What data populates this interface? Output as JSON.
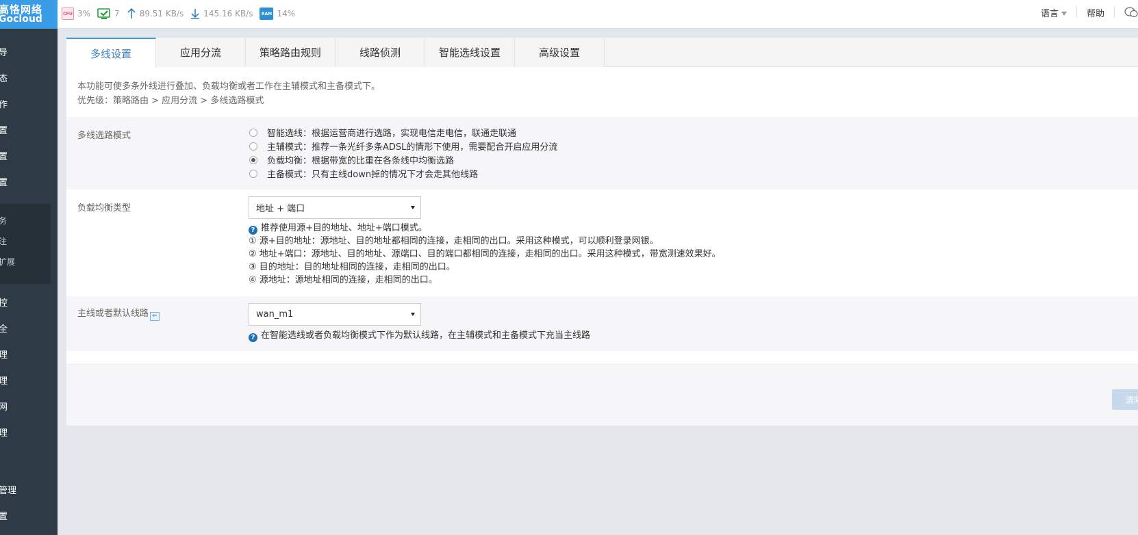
{
  "brand": {
    "name_cn": "高恪网络",
    "name_en": "Gocloud"
  },
  "stats": {
    "cpu_label": "CPU",
    "cpu": "3%",
    "connections": "7",
    "upload": "89.51 KB/s",
    "download": "145.16 KB/s",
    "ram_label": "RAM",
    "ram": "14%"
  },
  "topnav": {
    "language": "语言",
    "help": "帮助"
  },
  "sidebar": {
    "items": [
      "导",
      "态",
      "作",
      "置",
      "置",
      "置"
    ],
    "sub_items": [
      "务",
      "注",
      "扩展"
    ],
    "items2": [
      "控",
      "全",
      "理",
      "理",
      "网",
      "理"
    ],
    "items3": [
      "管理",
      "置"
    ]
  },
  "tabs": [
    "多线设置",
    "应用分流",
    "策略路由规则",
    "线路侦测",
    "智能选线设置",
    "高级设置"
  ],
  "intro": {
    "line1": "本功能可使多条外线进行叠加、负载均衡或者工作在主辅模式和主备模式下。",
    "line2": "优先级：策略路由 > 应用分流 > 多线选路模式"
  },
  "mode": {
    "label": "多线选路模式",
    "options": [
      {
        "text": "智能选线：根据运营商进行选路，实现电信走电信，联通走联通",
        "checked": false
      },
      {
        "text": "主辅模式：推荐一条光纤多条ADSL的情形下使用，需要配合开启应用分流",
        "checked": false
      },
      {
        "text": "负载均衡：根据带宽的比重在各条线中均衡选路",
        "checked": true
      },
      {
        "text": "主备模式：只有主线down掉的情况下才会走其他线路",
        "checked": false
      }
    ]
  },
  "balance": {
    "label": "负载均衡类型",
    "value": "地址 + 端口",
    "hints": [
      "推荐使用源+目的地址、地址+端口模式。",
      "① 源+目的地址：源地址、目的地址都相同的连接，走相同的出口。采用这种模式，可以顺利登录网银。",
      "② 地址+端口：源地址、目的地址、源端口、目的端口都相同的连接，走相同的出口。采用这种模式，带宽测速效果好。",
      "③ 目的地址：目的地址相同的连接，走相同的出口。",
      "④ 源地址：源地址相同的连接，走相同的出口。"
    ]
  },
  "default_line": {
    "label": "主线或者默认线路",
    "value": "wan_m1",
    "hint": "在智能选线或者负载均衡模式下作为默认线路，在主辅模式和主备模式下充当主线路"
  },
  "actions": {
    "clear": "清除"
  }
}
